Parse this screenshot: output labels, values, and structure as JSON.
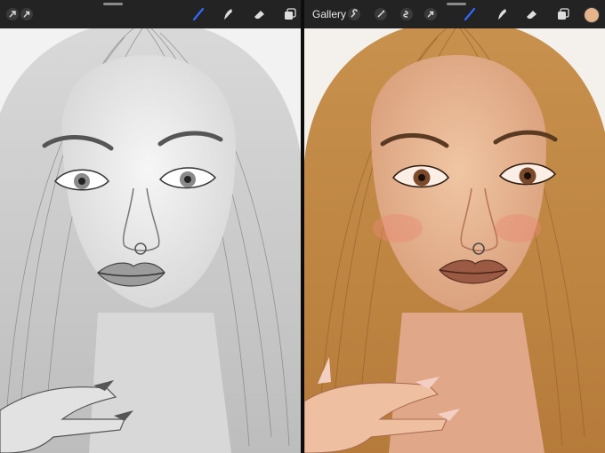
{
  "app": {
    "gallery_label": "Gallery",
    "active_color": "#e5b48b",
    "accent_color": "#2f6bff"
  },
  "left_toolbar": {
    "icons": [
      "actions-icon",
      "transform-arrow-icon",
      "brush-icon",
      "smudge-icon",
      "eraser-icon",
      "layers-icon"
    ]
  },
  "right_toolbar": {
    "icons": [
      "wrench-icon",
      "magic-wand-icon",
      "selection-icon",
      "transform-arrow-icon",
      "brush-icon",
      "smudge-icon",
      "eraser-icon",
      "layers-icon",
      "color-swatch-icon"
    ]
  },
  "canvases": {
    "left": "pencil-sketch-portrait",
    "right": "colored-painted-portrait"
  }
}
